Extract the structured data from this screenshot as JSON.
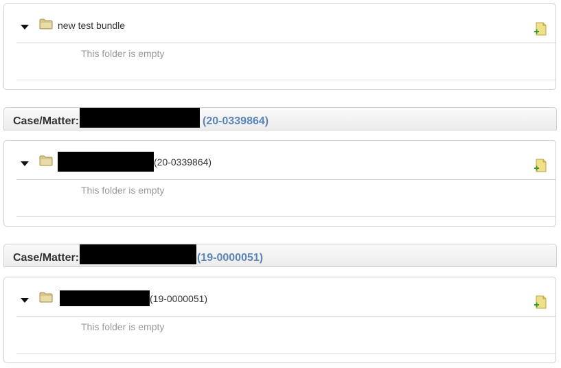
{
  "bundles": [
    {
      "title": "new test bundle",
      "matter_number": "",
      "empty_message": "This folder is empty"
    },
    {
      "title": "",
      "matter_number": "(20-0339864)",
      "empty_message": "This folder is empty"
    },
    {
      "title": "",
      "matter_number": "(19-0000051)",
      "empty_message": "This folder is empty"
    }
  ],
  "case_headers": [
    {
      "label": "Case/Matter:",
      "number": "(20-0339864)"
    },
    {
      "label": "Case/Matter:",
      "number": "(19-0000051)"
    }
  ],
  "icons": {
    "expand": "caret-down-icon",
    "folder": "folder-icon",
    "add": "add-document-icon"
  },
  "colors": {
    "case_number": "#5b85b8",
    "empty_text": "#999999",
    "border": "#cfcfcf"
  }
}
